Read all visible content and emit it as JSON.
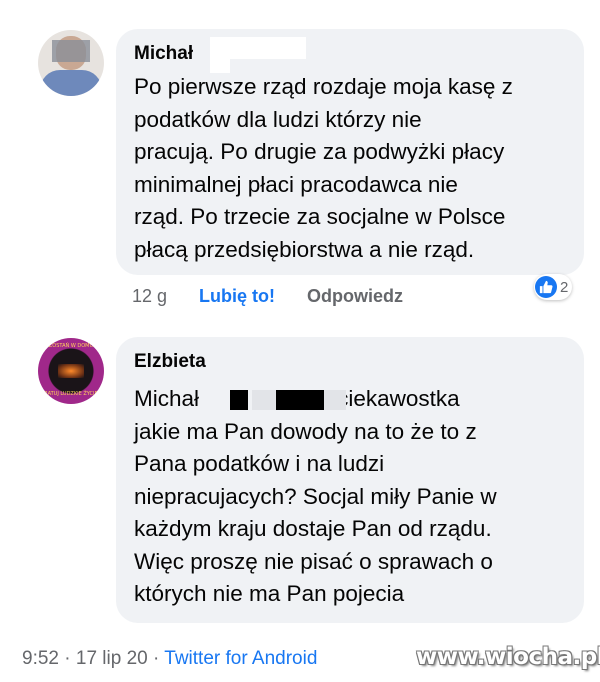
{
  "comment1": {
    "author": "Michał",
    "text": "Po pierwsze rząd rozdaje moja kasę z\npodatków dla ludzi którzy nie\npracują. Po drugie za podwyżki płacy\nminimalnej płaci pracodawca nie\nrząd. Po trzecie za socjalne w Polsce\npłacą przedsiębiorstwa a nie rząd.",
    "time": "12 g",
    "like_label": "Lubię to!",
    "reply_label": "Odpowiedz",
    "reaction_count": "2",
    "reaction_icon": "thumbs-up-icon"
  },
  "comment2": {
    "author": "Elzbieta",
    "mention": "Michał",
    "text_after_mention": ". To ciekawostka\njakie ma Pan dowody na to że to z\nPana podatków i na ludzi\nniepracujacych?  Socjal miły Panie w\nkażdym kraju  dostaje Pan od rządu.\nWięc proszę nie pisać  o sprawach o\nktórych nie ma Pan pojecia",
    "avatar_text_top": "ZOSTAŃ W DOMU",
    "avatar_text_bottom": "RATUJ LUDZKIE ŻYCIE"
  },
  "footer": {
    "time": "9:52",
    "sep": " · ",
    "date": "17 lip 20",
    "source": "Twitter for Android"
  },
  "watermark": "www.wiocha.pl",
  "colors": {
    "bubble": "#f0f2f5",
    "link": "#1877f2",
    "meta": "#65676b"
  }
}
